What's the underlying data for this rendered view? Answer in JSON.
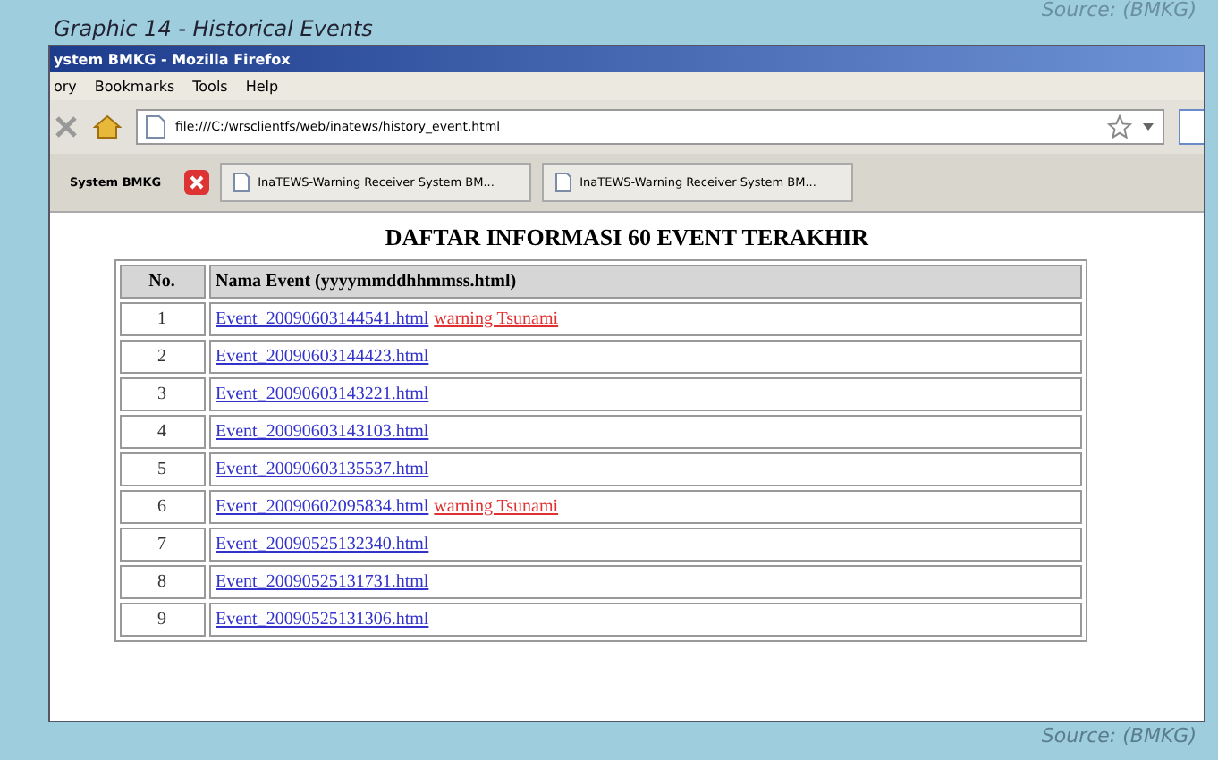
{
  "source_top": "Source: (BMKG)",
  "caption": "Graphic 14 - Historical Events",
  "window": {
    "title": "ystem BMKG - Mozilla Firefox"
  },
  "menu": [
    "ory",
    "Bookmarks",
    "Tools",
    "Help"
  ],
  "address": {
    "value": "file:///C:/wrsclientfs/web/inatews/history_event.html"
  },
  "tabs": [
    {
      "label": "System BMKG",
      "selected": true
    },
    {
      "label": "InaTEWS-Warning Receiver System BM...",
      "selected": false
    },
    {
      "label": "InaTEWS-Warning Receiver System BM...",
      "selected": false
    }
  ],
  "page": {
    "heading": "DAFTAR INFORMASI 60 EVENT TERAKHIR",
    "columns": [
      "No.",
      "Nama Event (yyyymmddhhmmss.html)"
    ],
    "rows": [
      {
        "no": "1",
        "event": "Event_20090603144541.html",
        "warning": "warning Tsunami"
      },
      {
        "no": "2",
        "event": "Event_20090603144423.html"
      },
      {
        "no": "3",
        "event": "Event_20090603143221.html"
      },
      {
        "no": "4",
        "event": "Event_20090603143103.html"
      },
      {
        "no": "5",
        "event": "Event_20090603135537.html"
      },
      {
        "no": "6",
        "event": "Event_20090602095834.html",
        "warning": "warning Tsunami"
      },
      {
        "no": "7",
        "event": "Event_20090525132340.html"
      },
      {
        "no": "8",
        "event": "Event_20090525131731.html"
      },
      {
        "no": "9",
        "event": "Event_20090525131306.html"
      }
    ]
  },
  "source_bottom": "Source: (BMKG)"
}
